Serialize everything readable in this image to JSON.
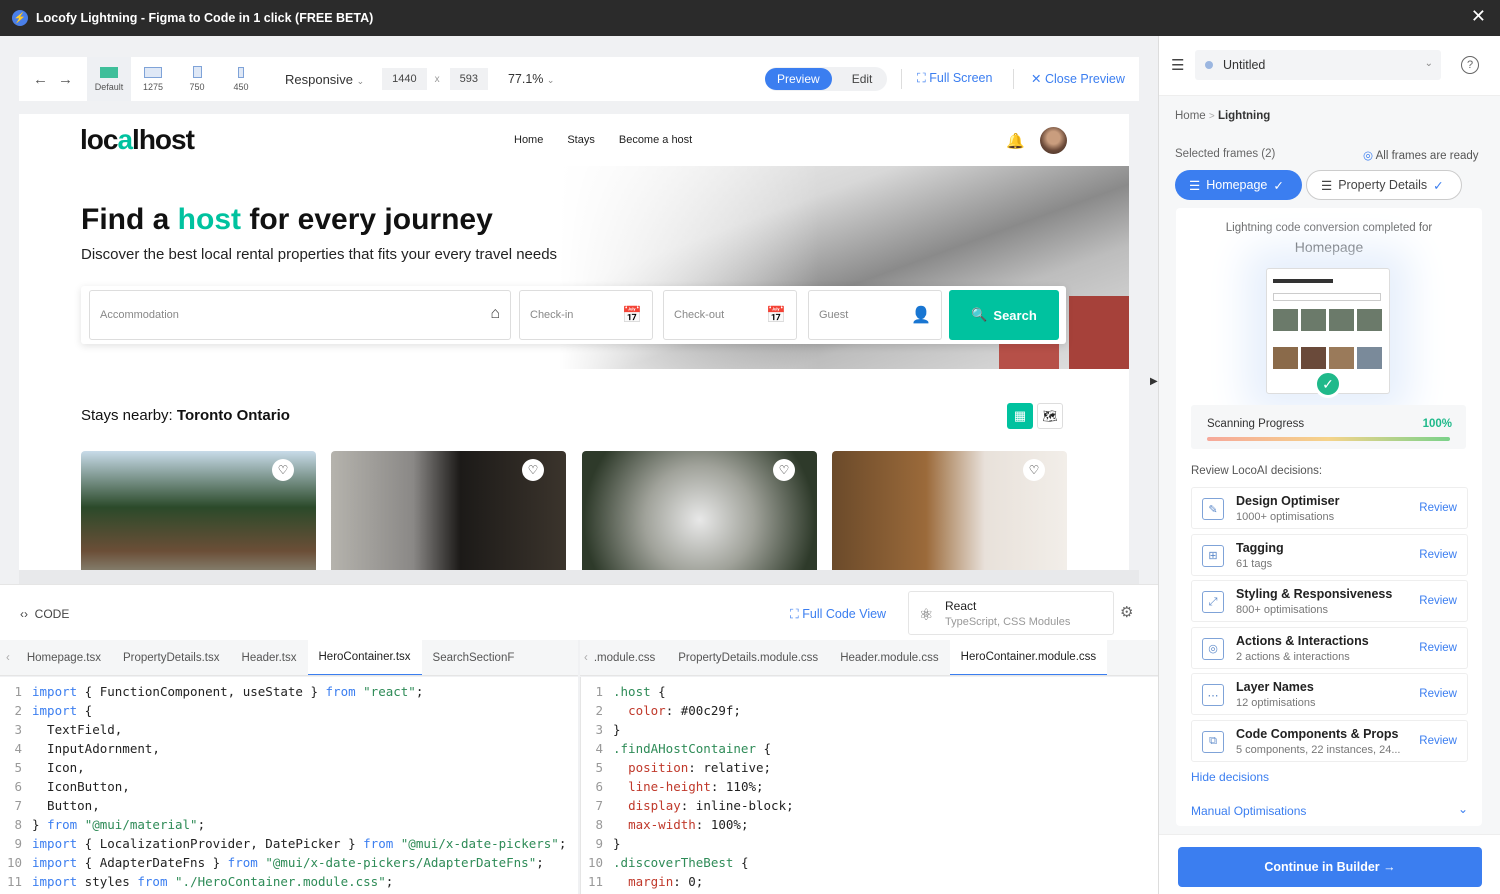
{
  "window": {
    "title": "Locofy Lightning - Figma to Code in 1 click (FREE BETA)"
  },
  "toolbar": {
    "devices": [
      {
        "label": "Default"
      },
      {
        "label": "1275"
      },
      {
        "label": "750"
      },
      {
        "label": "450"
      }
    ],
    "responsive": "Responsive",
    "width": "1440",
    "times": "x",
    "height": "593",
    "zoom": "77.1%",
    "preview": "Preview",
    "edit": "Edit",
    "full_screen": "Full Screen",
    "close_preview": "Close Preview"
  },
  "site": {
    "logo_a": "loc",
    "logo_o": "a",
    "logo_b": "lhost",
    "nav": [
      "Home",
      "Stays",
      "Become a host"
    ],
    "hero_title_a": "Find a ",
    "hero_title_hl": "host",
    "hero_title_b": " for every journey",
    "hero_sub": "Discover the best local rental properties that fits your every travel needs",
    "search": {
      "accommodation": "Accommodation",
      "checkin": "Check-in",
      "checkout": "Check-out",
      "guest": "Guest",
      "button": "Search"
    },
    "stays_prefix": "Stays nearby: ",
    "stays_location": "Toronto Ontario"
  },
  "code": {
    "label": "CODE",
    "full_code_view": "Full Code View",
    "framework": "React",
    "framework_sub": "TypeScript, CSS Modules",
    "left_tabs": [
      "Homepage.tsx",
      "PropertyDetails.tsx",
      "Header.tsx",
      "HeroContainer.tsx",
      "SearchSectionF"
    ],
    "right_tabs": [
      ".module.css",
      "PropertyDetails.module.css",
      "Header.module.css",
      "HeroContainer.module.css"
    ],
    "left_lines": [
      {
        "n": "1",
        "html": "<span class='kw'>import</span> { FunctionComponent, useState } <span class='kw'>from</span> <span class='str'>\"react\"</span>;"
      },
      {
        "n": "2",
        "html": "<span class='kw'>import</span> {"
      },
      {
        "n": "3",
        "html": "  TextField,"
      },
      {
        "n": "4",
        "html": "  InputAdornment,"
      },
      {
        "n": "5",
        "html": "  Icon,"
      },
      {
        "n": "6",
        "html": "  IconButton,"
      },
      {
        "n": "7",
        "html": "  Button,"
      },
      {
        "n": "8",
        "html": "} <span class='kw'>from</span> <span class='str'>\"@mui/material\"</span>;"
      },
      {
        "n": "9",
        "html": "<span class='kw'>import</span> { LocalizationProvider, DatePicker } <span class='kw'>from</span> <span class='str'>\"@mui/x-date-pickers\"</span>;"
      },
      {
        "n": "10",
        "html": "<span class='kw'>import</span> { AdapterDateFns } <span class='kw'>from</span> <span class='str'>\"@mui/x-date-pickers/AdapterDateFns\"</span>;"
      },
      {
        "n": "11",
        "html": "<span class='kw'>import</span> styles <span class='kw'>from</span> <span class='str'>\"./HeroContainer.module.css\"</span>;"
      }
    ],
    "right_lines": [
      {
        "n": "1",
        "html": "<span class='sel'>.host</span> {"
      },
      {
        "n": "2",
        "html": "  <span class='num'>color</span>: #00c29f;"
      },
      {
        "n": "3",
        "html": "}"
      },
      {
        "n": "4",
        "html": "<span class='sel'>.findAHostContainer</span> {"
      },
      {
        "n": "5",
        "html": "  <span class='num'>position</span>: relative;"
      },
      {
        "n": "6",
        "html": "  <span class='num'>line-height</span>: 110%;"
      },
      {
        "n": "7",
        "html": "  <span class='num'>display</span>: inline-block;"
      },
      {
        "n": "8",
        "html": "  <span class='num'>max-width</span>: 100%;"
      },
      {
        "n": "9",
        "html": "}"
      },
      {
        "n": "10",
        "html": "<span class='sel'>.discoverTheBest</span> {"
      },
      {
        "n": "11",
        "html": "  <span class='num'>margin</span>: 0;"
      }
    ]
  },
  "panel": {
    "project": "Untitled",
    "crumb_home": "Home",
    "crumb_sep": ">",
    "crumb_current": "Lightning",
    "selected_frames": "Selected frames (2)",
    "all_ready": "All frames are ready",
    "chip_a": "Homepage",
    "chip_b": "Property Details",
    "completed_text": "Lightning code conversion completed for",
    "completed_frame": "Homepage",
    "scan_label": "Scanning Progress",
    "scan_pct": "100%",
    "scan_value": 1.0,
    "review_label": "Review LocoAI decisions:",
    "decisions": [
      {
        "name": "Design Optimiser",
        "sub": "1000+ optimisations",
        "review": "Review"
      },
      {
        "name": "Tagging",
        "sub": "61 tags",
        "review": "Review"
      },
      {
        "name": "Styling & Responsiveness",
        "sub": "800+ optimisations",
        "review": "Review"
      },
      {
        "name": "Actions & Interactions",
        "sub": "2 actions & interactions",
        "review": "Review"
      },
      {
        "name": "Layer Names",
        "sub": "12 optimisations",
        "review": "Review"
      },
      {
        "name": "Code Components & Props",
        "sub": "5 components, 22 instances, 24...",
        "review": "Review"
      }
    ],
    "hide_decisions": "Hide decisions",
    "manual": "Manual Optimisations",
    "continue": "Continue in Builder →"
  }
}
